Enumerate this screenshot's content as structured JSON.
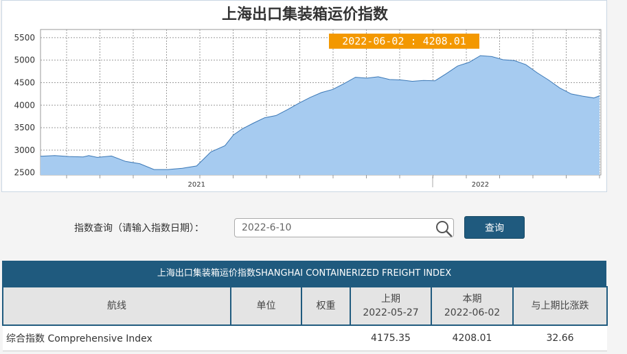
{
  "chart": {
    "title": "上海出口集装箱运价指数",
    "tooltip": "2022-06-02 : 4208.01",
    "y_ticks": [
      "5500",
      "5000",
      "4500",
      "4000",
      "3500",
      "3000",
      "2500"
    ],
    "x_ticks": [
      "2021",
      "2022"
    ]
  },
  "chart_data": {
    "type": "area",
    "title": "上海出口集装箱运价指数",
    "xlabel": "",
    "ylabel": "",
    "ylim": [
      2450,
      5680
    ],
    "x": [
      2020.45,
      2020.5,
      2020.55,
      2020.6,
      2020.62,
      2020.65,
      2020.7,
      2020.75,
      2020.8,
      2020.85,
      2020.9,
      2020.95,
      2021.0,
      2021.05,
      2021.1,
      2021.13,
      2021.16,
      2021.2,
      2021.24,
      2021.28,
      2021.32,
      2021.36,
      2021.4,
      2021.44,
      2021.48,
      2021.52,
      2021.56,
      2021.6,
      2021.64,
      2021.68,
      2021.72,
      2021.76,
      2021.8,
      2021.84,
      2021.88,
      2021.92,
      2021.96,
      2022.0,
      2022.04,
      2022.08,
      2022.12,
      2022.16,
      2022.2,
      2022.24,
      2022.28,
      2022.32,
      2022.36,
      2022.4,
      2022.42
    ],
    "series": [
      {
        "values": [
          2865,
          2880,
          2860,
          2850,
          2880,
          2840,
          2870,
          2750,
          2700,
          2570,
          2570,
          2600,
          2650,
          2960,
          3100,
          3340,
          3470,
          3600,
          3720,
          3770,
          3900,
          4040,
          4170,
          4280,
          4350,
          4480,
          4620,
          4600,
          4630,
          4570,
          4560,
          4530,
          4550,
          4540,
          4700,
          4870,
          4950,
          5100,
          5080,
          5010,
          4990,
          4900,
          4720,
          4560,
          4380,
          4250,
          4200,
          4160,
          4208
        ]
      }
    ],
    "grid": true
  },
  "query": {
    "label": "指数查询（请输入指数日期）：",
    "value": "2022-6-10",
    "button": "查询"
  },
  "table": {
    "title": "上海出口集装箱运价指数SHANGHAI CONTAINERIZED FREIGHT INDEX",
    "headers": {
      "route": "航线",
      "unit": "单位",
      "weight": "权重",
      "prev_label": "上期",
      "prev_date": "2022-05-27",
      "curr_label": "本期",
      "curr_date": "2022-06-02",
      "change": "与上期比涨跌"
    },
    "rows": [
      {
        "route": "综合指数 Comprehensive Index",
        "unit": "",
        "weight": "",
        "prev": "4175.35",
        "curr": "4208.01",
        "change": "32.66"
      }
    ]
  },
  "colors": {
    "accent": "#1f5a7e",
    "area_fill": "#a6cbf0",
    "area_line": "#3a77b5",
    "tooltip": "#f39800"
  }
}
